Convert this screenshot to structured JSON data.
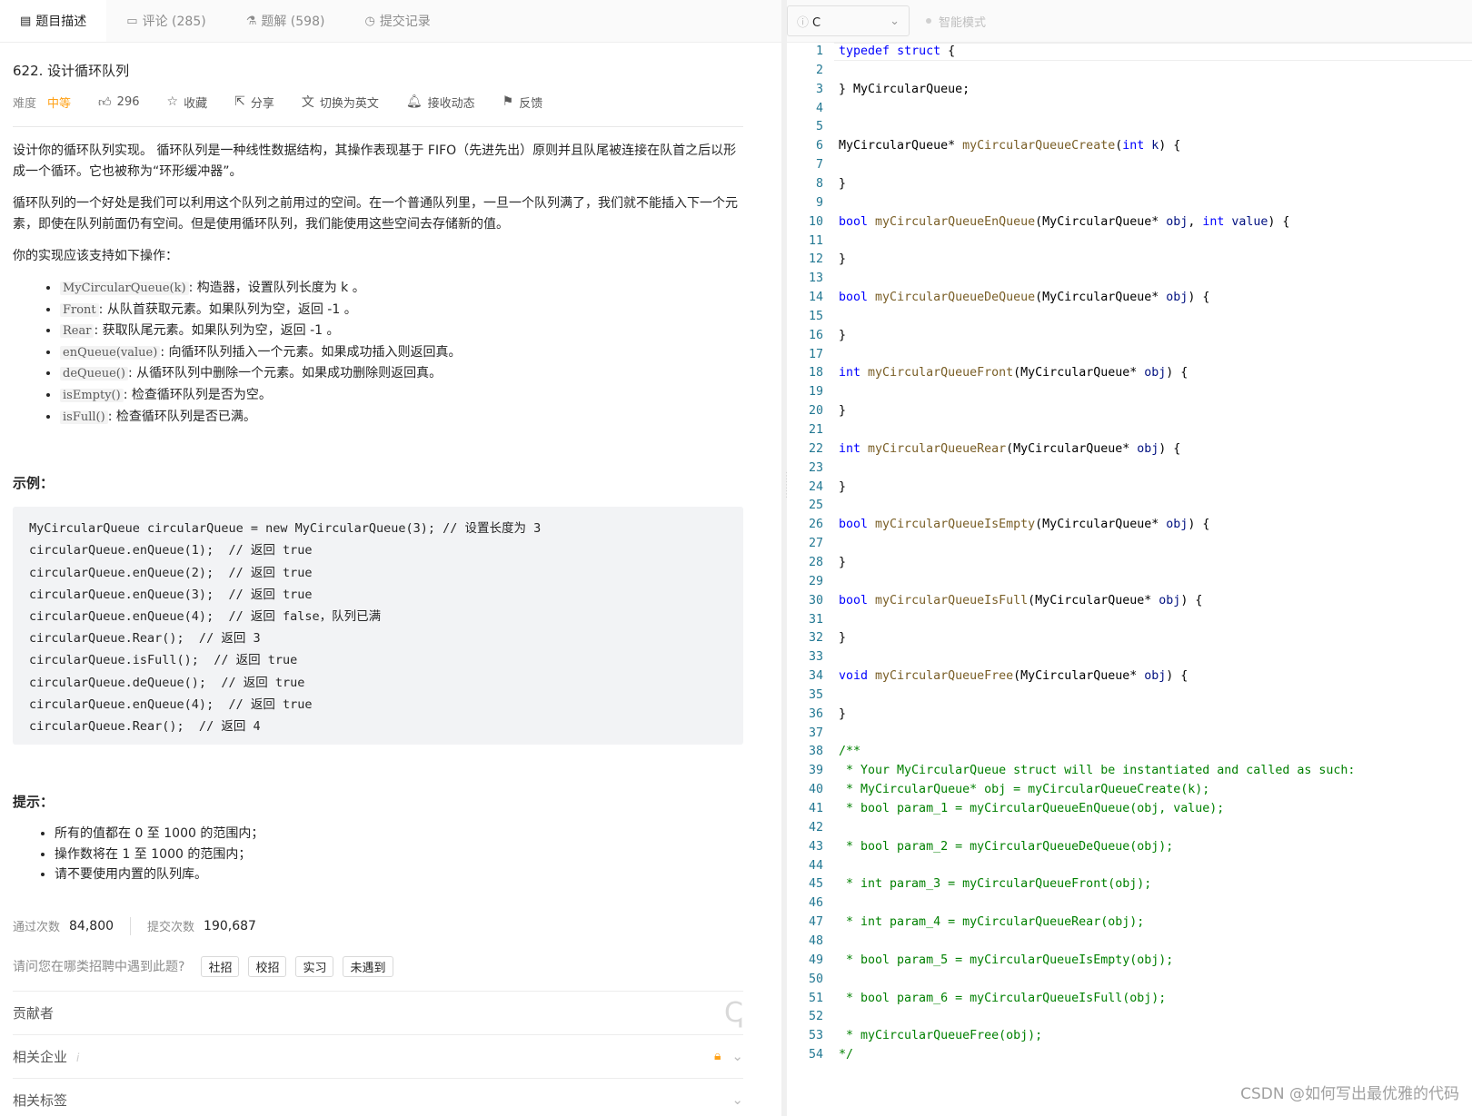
{
  "tabs": [
    {
      "label": "题目描述",
      "icon": "doc-icon"
    },
    {
      "label": "评论 (285)",
      "icon": "comment-icon"
    },
    {
      "label": "题解 (598)",
      "icon": "flask-icon"
    },
    {
      "label": "提交记录",
      "icon": "clock-icon"
    }
  ],
  "problem": {
    "title": "622. 设计循环队列",
    "difficulty_label": "难度",
    "difficulty": "中等",
    "likes": "296",
    "actions": [
      "收藏",
      "分享",
      "切换为英文",
      "接收动态",
      "反馈"
    ]
  },
  "description": {
    "p1": "设计你的循环队列实现。 循环队列是一种线性数据结构，其操作表现基于 FIFO（先进先出）原则并且队尾被连接在队首之后以形成一个循环。它也被称为“环形缓冲器”。",
    "p2": "循环队列的一个好处是我们可以利用这个队列之前用过的空间。在一个普通队列里，一旦一个队列满了，我们就不能插入下一个元素，即使在队列前面仍有空间。但是使用循环队列，我们能使用这些空间去存储新的值。",
    "p3": "你的实现应该支持如下操作：",
    "ops": [
      {
        "code": "MyCircularQueue(k)",
        "text": ": 构造器，设置队列长度为 k 。"
      },
      {
        "code": "Front",
        "text": ": 从队首获取元素。如果队列为空，返回 -1 。"
      },
      {
        "code": "Rear",
        "text": ": 获取队尾元素。如果队列为空，返回 -1 。"
      },
      {
        "code": "enQueue(value)",
        "text": ": 向循环队列插入一个元素。如果成功插入则返回真。"
      },
      {
        "code": "deQueue()",
        "text": ": 从循环队列中删除一个元素。如果成功删除则返回真。"
      },
      {
        "code": "isEmpty()",
        "text": ": 检查循环队列是否为空。"
      },
      {
        "code": "isFull()",
        "text": ": 检查循环队列是否已满。"
      }
    ]
  },
  "example": {
    "heading": "示例：",
    "code": "MyCircularQueue circularQueue = new MyCircularQueue(3); // 设置长度为 3\ncircularQueue.enQueue(1);  // 返回 true\ncircularQueue.enQueue(2);  // 返回 true\ncircularQueue.enQueue(3);  // 返回 true\ncircularQueue.enQueue(4);  // 返回 false，队列已满\ncircularQueue.Rear();  // 返回 3\ncircularQueue.isFull();  // 返回 true\ncircularQueue.deQueue();  // 返回 true\ncircularQueue.enQueue(4);  // 返回 true\ncircularQueue.Rear();  // 返回 4"
  },
  "hints": {
    "heading": "提示：",
    "items": [
      "所有的值都在 0 至 1000 的范围内；",
      "操作数将在 1 至 1000 的范围内；",
      "请不要使用内置的队列库。"
    ]
  },
  "stats": {
    "accepted_label": "通过次数",
    "accepted": "84,800",
    "submitted_label": "提交次数",
    "submitted": "190,687"
  },
  "recruit": {
    "question": "请问您在哪类招聘中遇到此题?",
    "chips": [
      "社招",
      "校招",
      "实习",
      "未遇到"
    ]
  },
  "folds": {
    "contributors": "贡献者",
    "companies": "相关企业",
    "tags": "相关标签"
  },
  "editor": {
    "language": "C",
    "smart_mode": "智能模式",
    "lines": [
      "typedef struct {",
      "",
      "} MyCircularQueue;",
      "",
      "",
      "MyCircularQueue* myCircularQueueCreate(int k) {",
      "",
      "}",
      "",
      "bool myCircularQueueEnQueue(MyCircularQueue* obj, int value) {",
      "",
      "}",
      "",
      "bool myCircularQueueDeQueue(MyCircularQueue* obj) {",
      "",
      "}",
      "",
      "int myCircularQueueFront(MyCircularQueue* obj) {",
      "",
      "}",
      "",
      "int myCircularQueueRear(MyCircularQueue* obj) {",
      "",
      "}",
      "",
      "bool myCircularQueueIsEmpty(MyCircularQueue* obj) {",
      "",
      "}",
      "",
      "bool myCircularQueueIsFull(MyCircularQueue* obj) {",
      "",
      "}",
      "",
      "void myCircularQueueFree(MyCircularQueue* obj) {",
      "",
      "}",
      "",
      "/**",
      " * Your MyCircularQueue struct will be instantiated and called as such:",
      " * MyCircularQueue* obj = myCircularQueueCreate(k);",
      " * bool param_1 = myCircularQueueEnQueue(obj, value);",
      "",
      " * bool param_2 = myCircularQueueDeQueue(obj);",
      "",
      " * int param_3 = myCircularQueueFront(obj);",
      "",
      " * int param_4 = myCircularQueueRear(obj);",
      "",
      " * bool param_5 = myCircularQueueIsEmpty(obj);",
      "",
      " * bool param_6 = myCircularQueueIsFull(obj);",
      "",
      " * myCircularQueueFree(obj);",
      "*/"
    ]
  },
  "watermark": "CSDN @如何写出最优雅的代码"
}
